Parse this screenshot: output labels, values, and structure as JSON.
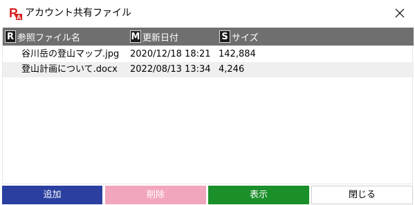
{
  "window": {
    "title": "アカウント共有ファイル",
    "colors": {
      "app_icon_bg": "#ffffff",
      "app_icon_red": "#d62020",
      "header_bg": "#6f6f6f"
    }
  },
  "table": {
    "columns": [
      {
        "key": "R",
        "label": "参照ファイル名"
      },
      {
        "key": "M",
        "label": "更新日付"
      },
      {
        "key": "S",
        "label": "サイズ"
      }
    ],
    "rows": [
      {
        "name": "谷川岳の登山マップ.jpg",
        "date": "2020/12/18 18:21",
        "size": "142,884"
      },
      {
        "name": "登山計画について.docx",
        "date": "2022/08/13 13:34",
        "size": "4,246"
      }
    ]
  },
  "buttons": {
    "add": "追加",
    "delete": "削除",
    "show": "表示",
    "close": "閉じる"
  },
  "icons": {
    "app": "app-logo-icon",
    "close": "close-icon"
  }
}
